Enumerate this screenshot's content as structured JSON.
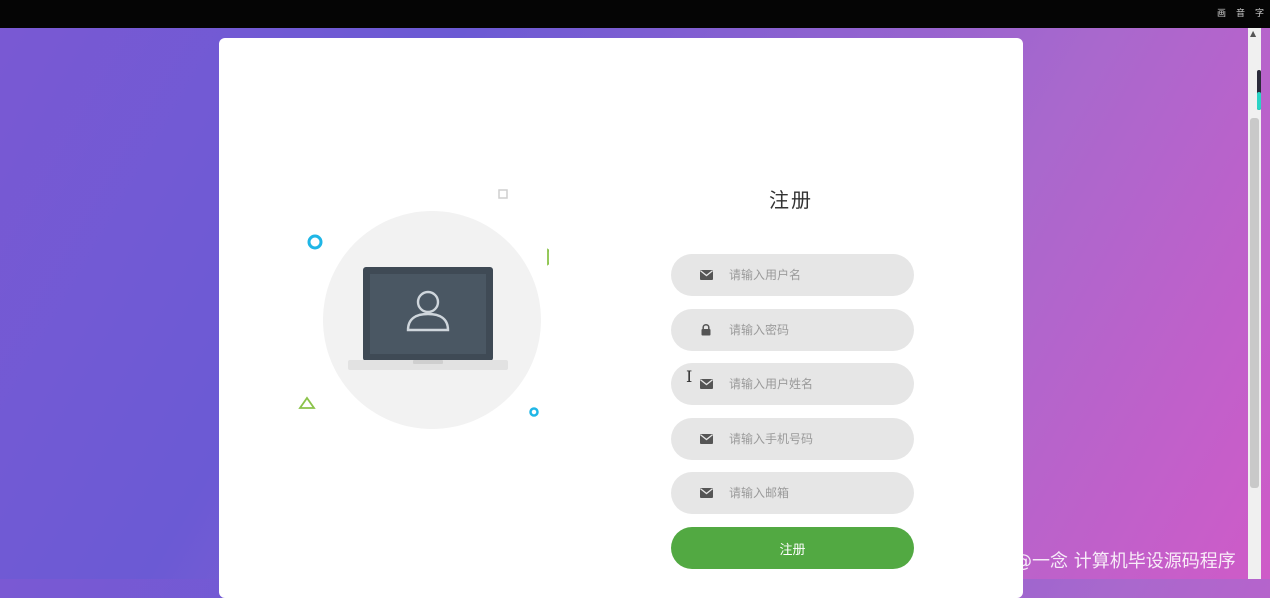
{
  "toolbar": {
    "items": [
      "画",
      "音",
      "字"
    ]
  },
  "register": {
    "title": "注册",
    "fields": [
      {
        "icon": "envelope-icon",
        "placeholder": "请输入用户名"
      },
      {
        "icon": "lock-icon",
        "placeholder": "请输入密码"
      },
      {
        "icon": "envelope-icon",
        "placeholder": "请输入用户姓名"
      },
      {
        "icon": "envelope-icon",
        "placeholder": "请输入手机号码"
      },
      {
        "icon": "envelope-icon",
        "placeholder": "请输入邮箱"
      }
    ],
    "submit_label": "注册"
  },
  "cursor_glyph": "I",
  "watermark": "CSDN @一念 计算机毕设源码程序",
  "colors": {
    "submit": "#52a942",
    "field_bg": "#e6e6e6",
    "accent_cyan": "#1fb6e6",
    "accent_green": "#8bc34a",
    "laptop": "#3f4a55"
  }
}
